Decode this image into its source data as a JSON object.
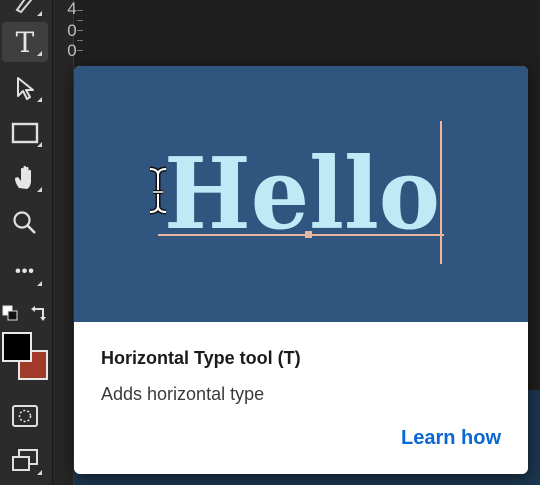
{
  "ruler": {
    "numbers": [
      "4",
      "0",
      "0"
    ]
  },
  "toolbar": {
    "tools": [
      {
        "icon": "pen-icon"
      },
      {
        "icon": "horizontal-type-icon",
        "label": "T"
      },
      {
        "icon": "path-selection-icon"
      },
      {
        "icon": "rectangle-icon"
      },
      {
        "icon": "hand-icon"
      },
      {
        "icon": "zoom-icon"
      },
      {
        "icon": "more-tools-icon",
        "label": "•••"
      },
      {
        "icon": "quick-mask-icon"
      },
      {
        "icon": "change-screen-mode-icon"
      }
    ],
    "foreground_color": "#000000",
    "background_color": "#a23a2a"
  },
  "tooltip": {
    "preview_text": "Hello",
    "title": "Horizontal Type tool (T)",
    "description": "Adds horizontal type",
    "link": "Learn how"
  }
}
